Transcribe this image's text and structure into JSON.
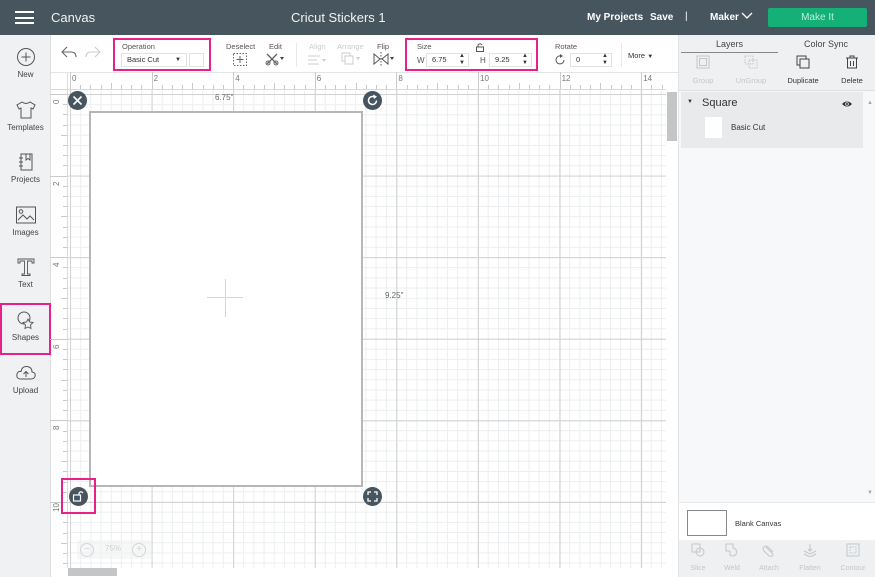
{
  "topbar": {
    "app_title": "Canvas",
    "project_title": "Cricut Stickers 1",
    "my_projects": "My Projects",
    "save": "Save",
    "separator": "|",
    "machine": "Maker",
    "make_it": "Make It",
    "make_it_color": "#14b078",
    "bar_color": "#46555e"
  },
  "sidebar": {
    "items": [
      {
        "label": "New",
        "icon": "plus-circle-icon"
      },
      {
        "label": "Templates",
        "icon": "tshirt-icon"
      },
      {
        "label": "Projects",
        "icon": "notebook-icon"
      },
      {
        "label": "Images",
        "icon": "image-icon"
      },
      {
        "label": "Text",
        "icon": "text-t-icon"
      },
      {
        "label": "Shapes",
        "icon": "shapes-icon",
        "highlighted": true
      },
      {
        "label": "Upload",
        "icon": "cloud-upload-icon"
      }
    ]
  },
  "toolbar": {
    "operation_label": "Operation",
    "operation_value": "Basic Cut",
    "deselect": "Deselect",
    "edit": "Edit",
    "align": "Align",
    "arrange": "Arrange",
    "flip": "Flip",
    "size_label": "Size",
    "width_prefix": "W",
    "width_value": "6.75",
    "height_prefix": "H",
    "height_value": "9.25",
    "rotate_label": "Rotate",
    "rotate_value": "0",
    "more": "More"
  },
  "rulers": {
    "top": [
      "0",
      "2",
      "4",
      "6",
      "8",
      "10",
      "12",
      "14"
    ],
    "left": [
      "0",
      "2",
      "4",
      "6",
      "8",
      "10"
    ]
  },
  "canvas": {
    "width_label": "6.75\"",
    "height_label": "9.25\"",
    "zoom_value": "75%",
    "zoom_out": "−",
    "zoom_in": "+"
  },
  "layers_panel": {
    "tabs": [
      "Layers",
      "Color Sync"
    ],
    "active_tab": "Layers",
    "actions": [
      {
        "label": "Group",
        "enabled": false
      },
      {
        "label": "UnGroup",
        "enabled": false
      },
      {
        "label": "Duplicate",
        "enabled": true
      },
      {
        "label": "Delete",
        "enabled": true
      }
    ],
    "layer": {
      "name": "Square",
      "item_label": "Basic Cut"
    },
    "blank_canvas": "Blank Canvas",
    "bottom_actions": [
      "Slice",
      "Weld",
      "Attach",
      "Flatten",
      "Contour"
    ]
  },
  "highlight_color": "#e6218c"
}
